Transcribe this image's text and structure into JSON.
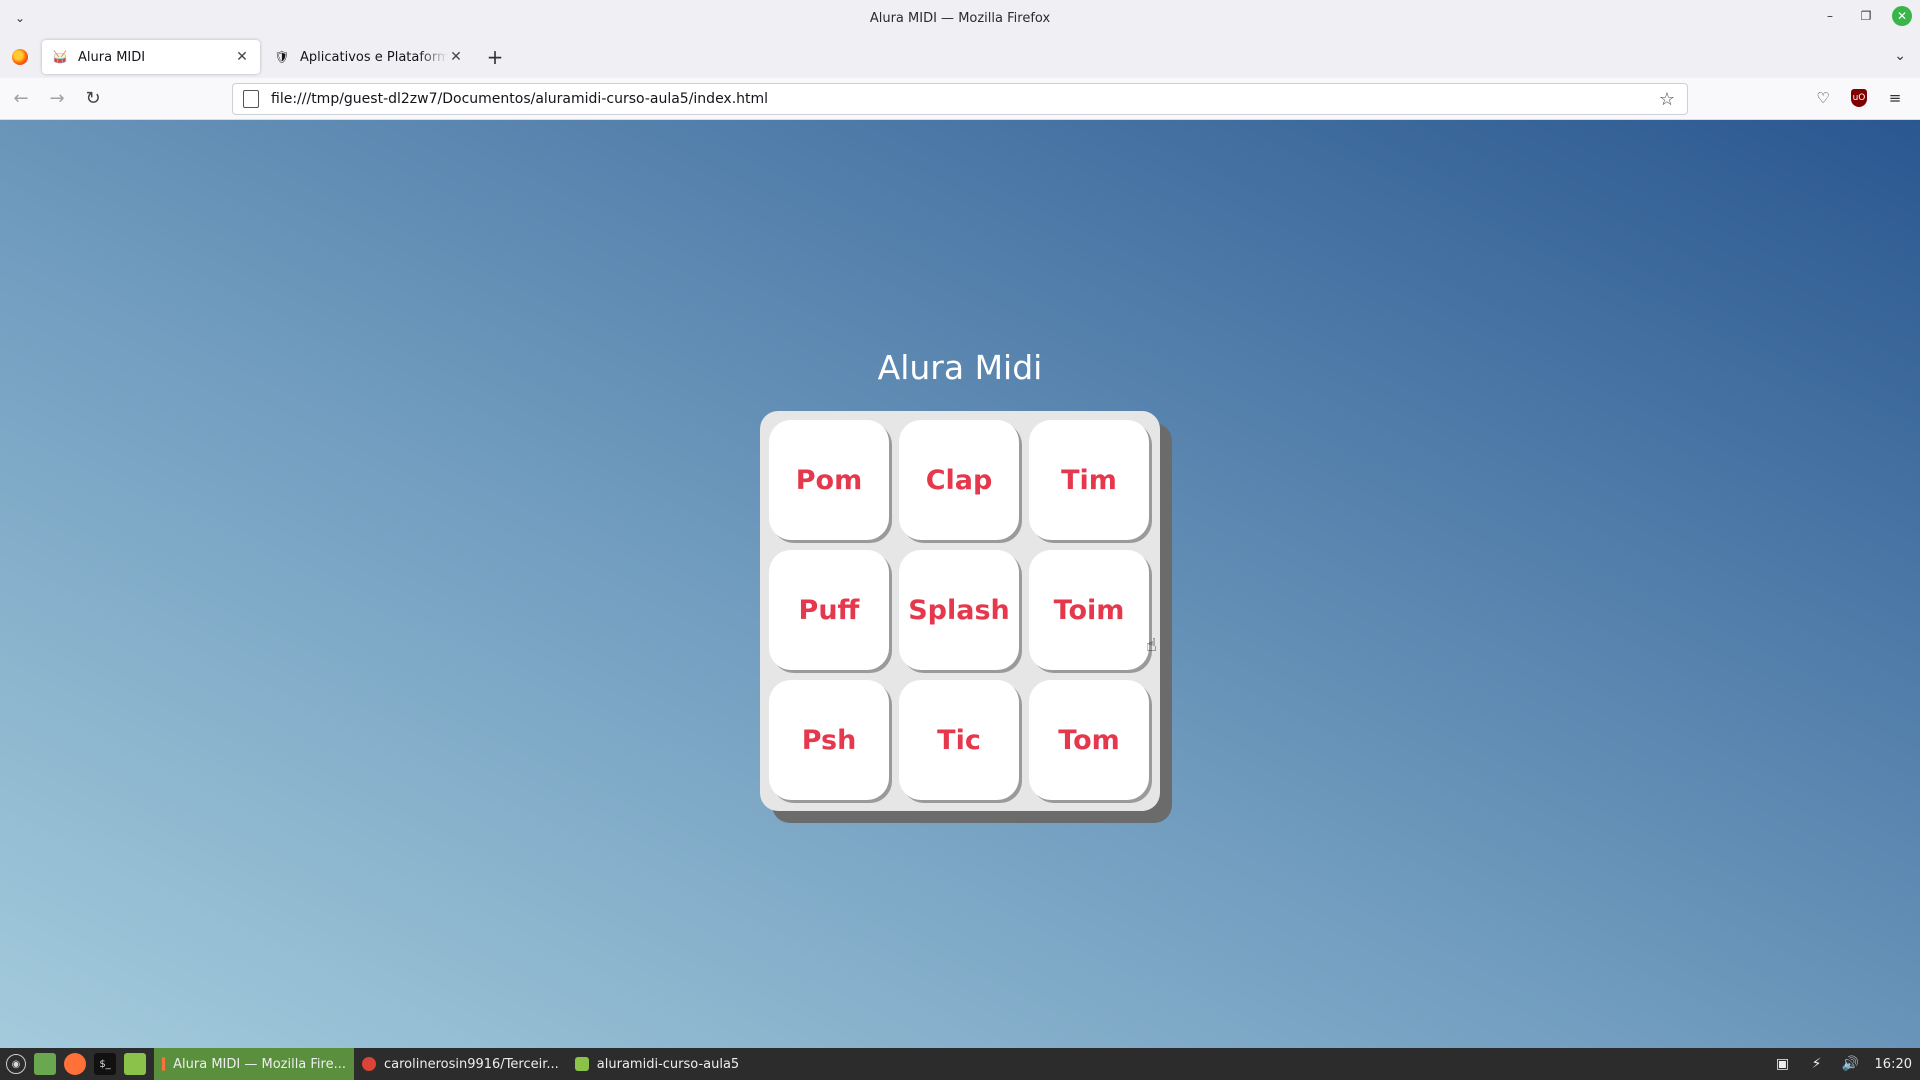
{
  "window": {
    "title": "Alura MIDI — Mozilla Firefox",
    "minimize": "–",
    "restore": "❐",
    "close": "✕",
    "menu": "⌄"
  },
  "tabs": [
    {
      "label": "Alura MIDI",
      "favicon": "drum-icon",
      "close": "✕"
    },
    {
      "label": "Aplicativos e Plataformas Ed",
      "favicon": "shield-icon",
      "close": "✕"
    }
  ],
  "toolbar": {
    "newtab": "+",
    "tablist": "⌄",
    "back": "←",
    "forward": "→",
    "reload": "↻",
    "url": "file:///tmp/guest-dl2zw7/Documentos/aluramidi-curso-aula5/index.html",
    "star": "☆",
    "pocket": "♡",
    "ublock": "uO",
    "appmenu": "≡"
  },
  "page": {
    "title": "Alura Midi",
    "pads": [
      "Pom",
      "Clap",
      "Tim",
      "Puff",
      "Splash",
      "Toim",
      "Psh",
      "Tic",
      "Tom"
    ]
  },
  "colors": {
    "pad_text": "#e5384c",
    "bg_start": "#a4cbdc",
    "bg_end": "#2a5790"
  },
  "taskbar": {
    "tasks": [
      {
        "label": "Alura MIDI — Mozilla Fire..."
      },
      {
        "label": "carolinerosin9916/Terceir..."
      },
      {
        "label": "aluramidi-curso-aula5"
      }
    ],
    "clock": "16:20"
  }
}
